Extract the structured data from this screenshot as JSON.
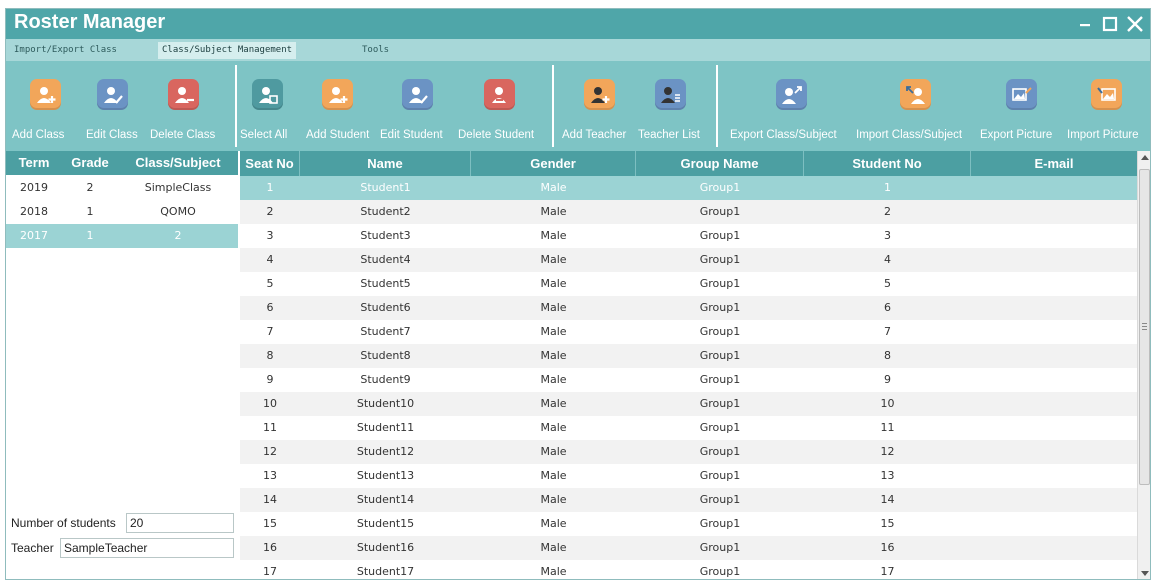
{
  "window": {
    "title": "Roster Manager"
  },
  "menu": [
    {
      "label": "Import/Export Class",
      "active": false
    },
    {
      "label": "Class/Subject Management",
      "active": true
    },
    {
      "label": "Tools",
      "active": false
    }
  ],
  "toolbar": {
    "add_class": "Add Class",
    "edit_class": "Edit Class",
    "delete_class": "Delete Class",
    "select_all": "Select All",
    "add_student": "Add Student",
    "edit_student": "Edit Student",
    "delete_student": "Delete Student",
    "add_teacher": "Add Teacher",
    "teacher_list": "Teacher List",
    "export_class": "Export Class/Subject",
    "import_class": "Import Class/Subject",
    "export_picture": "Export Picture",
    "import_picture": "Import Picture"
  },
  "class_table": {
    "headers": {
      "term": "Term",
      "grade": "Grade",
      "class": "Class/Subject"
    },
    "rows": [
      {
        "term": "2019",
        "grade": "2",
        "class": "SimpleClass",
        "selected": false
      },
      {
        "term": "2018",
        "grade": "1",
        "class": "QOMO",
        "selected": false
      },
      {
        "term": "2017",
        "grade": "1",
        "class": "2",
        "selected": true
      }
    ]
  },
  "summary": {
    "students_label": "Number of students",
    "students_value": "20",
    "teacher_label": "Teacher",
    "teacher_value": "SampleTeacher"
  },
  "student_table": {
    "headers": {
      "seat": "Seat No",
      "name": "Name",
      "gender": "Gender",
      "group": "Group Name",
      "student_no": "Student No",
      "email": "E-mail"
    },
    "rows": [
      {
        "seat": "1",
        "name": "Student1",
        "gender": "Male",
        "group": "Group1",
        "student_no": "1",
        "email": "",
        "selected": true
      },
      {
        "seat": "2",
        "name": "Student2",
        "gender": "Male",
        "group": "Group1",
        "student_no": "2",
        "email": ""
      },
      {
        "seat": "3",
        "name": "Student3",
        "gender": "Male",
        "group": "Group1",
        "student_no": "3",
        "email": ""
      },
      {
        "seat": "4",
        "name": "Student4",
        "gender": "Male",
        "group": "Group1",
        "student_no": "4",
        "email": ""
      },
      {
        "seat": "5",
        "name": "Student5",
        "gender": "Male",
        "group": "Group1",
        "student_no": "5",
        "email": ""
      },
      {
        "seat": "6",
        "name": "Student6",
        "gender": "Male",
        "group": "Group1",
        "student_no": "6",
        "email": ""
      },
      {
        "seat": "7",
        "name": "Student7",
        "gender": "Male",
        "group": "Group1",
        "student_no": "7",
        "email": ""
      },
      {
        "seat": "8",
        "name": "Student8",
        "gender": "Male",
        "group": "Group1",
        "student_no": "8",
        "email": ""
      },
      {
        "seat": "9",
        "name": "Student9",
        "gender": "Male",
        "group": "Group1",
        "student_no": "9",
        "email": ""
      },
      {
        "seat": "10",
        "name": "Student10",
        "gender": "Male",
        "group": "Group1",
        "student_no": "10",
        "email": ""
      },
      {
        "seat": "11",
        "name": "Student11",
        "gender": "Male",
        "group": "Group1",
        "student_no": "11",
        "email": ""
      },
      {
        "seat": "12",
        "name": "Student12",
        "gender": "Male",
        "group": "Group1",
        "student_no": "12",
        "email": ""
      },
      {
        "seat": "13",
        "name": "Student13",
        "gender": "Male",
        "group": "Group1",
        "student_no": "13",
        "email": ""
      },
      {
        "seat": "14",
        "name": "Student14",
        "gender": "Male",
        "group": "Group1",
        "student_no": "14",
        "email": ""
      },
      {
        "seat": "15",
        "name": "Student15",
        "gender": "Male",
        "group": "Group1",
        "student_no": "15",
        "email": ""
      },
      {
        "seat": "16",
        "name": "Student16",
        "gender": "Male",
        "group": "Group1",
        "student_no": "16",
        "email": ""
      },
      {
        "seat": "17",
        "name": "Student17",
        "gender": "Male",
        "group": "Group1",
        "student_no": "17",
        "email": ""
      }
    ]
  },
  "colors": {
    "title_bar": "#4fa6a9",
    "menu_bar": "#a7d7d8",
    "toolbar": "#7ec4c5",
    "header": "#4c9fa2",
    "selected_row": "#9bd3d4",
    "icon_orange": "#f2a65a",
    "icon_blue": "#6b93c4",
    "icon_red": "#d9665f",
    "icon_teal": "#4f9aa0"
  },
  "icons": [
    "minimize-icon",
    "maximize-icon",
    "close-icon",
    "add-class-icon",
    "edit-class-icon",
    "delete-class-icon",
    "select-all-icon",
    "add-student-icon",
    "edit-student-icon",
    "delete-student-icon",
    "add-teacher-icon",
    "teacher-list-icon",
    "export-class-icon",
    "import-class-icon",
    "export-picture-icon",
    "import-picture-icon",
    "scroll-up-arrow",
    "scroll-down-arrow"
  ]
}
